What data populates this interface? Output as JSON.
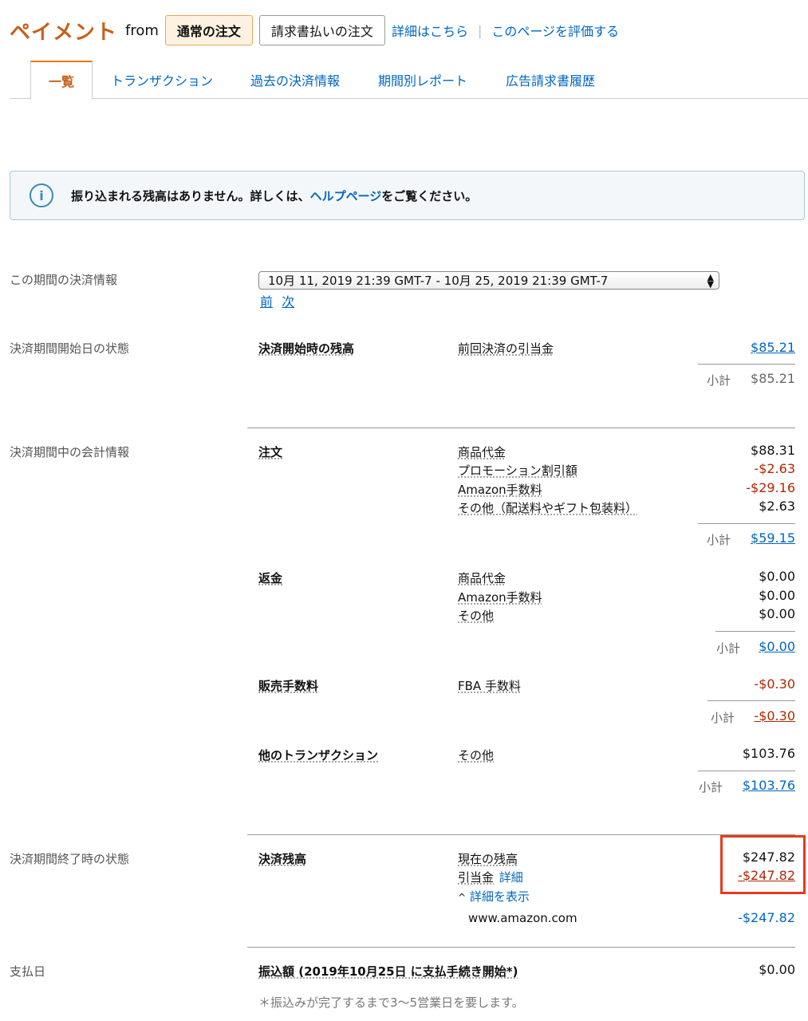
{
  "header": {
    "title": "ペイメント",
    "from": "from",
    "tab_regular": "通常の注文",
    "tab_invoice": "請求書払いの注文",
    "details_link": "詳細はこちら",
    "separator": "|",
    "rate_link": "このページを評価する"
  },
  "tabs": [
    "一覧",
    "トランザクション",
    "過去の決済情報",
    "期間別レポート",
    "広告請求書履歴"
  ],
  "info": {
    "icon": "info-icon",
    "icon_glyph": "i",
    "text_before": "振り込まれる残高はありません。詳しくは、",
    "link": "ヘルプページ",
    "text_after": "をご覧ください。"
  },
  "period": {
    "label": "この期間の決済情報",
    "selected": "10月 11, 2019 21:39 GMT-7 - 10月 25, 2019 21:39 GMT-7",
    "prev": "前",
    "next": "次"
  },
  "start": {
    "section": "決済期間開始日の状態",
    "group": "決済開始時の残高",
    "item": "前回決済の引当金",
    "amount": "$85.21",
    "subtotal_label": "小計",
    "subtotal": "$85.21"
  },
  "during": {
    "section": "決済期間中の会計情報",
    "orders": {
      "group": "注文",
      "items": [
        {
          "label": "商品代金",
          "amount": "$88.31"
        },
        {
          "label": "プロモーション割引額",
          "amount": "-$2.63"
        },
        {
          "label": "Amazon手数料",
          "amount": "-$29.16"
        },
        {
          "label": "その他（配送料やギフト包装料）",
          "amount": "$2.63"
        }
      ],
      "subtotal_label": "小計",
      "subtotal": "$59.15"
    },
    "refunds": {
      "group": "返金",
      "items": [
        {
          "label": "商品代金",
          "amount": "$0.00"
        },
        {
          "label": "Amazon手数料",
          "amount": "$0.00"
        },
        {
          "label": "その他",
          "amount": "$0.00"
        }
      ],
      "subtotal_label": "小計",
      "subtotal": "$0.00"
    },
    "fees": {
      "group": "販売手数料",
      "item": "FBA 手数料",
      "amount": "-$0.30",
      "subtotal_label": "小計",
      "subtotal": "-$0.30"
    },
    "other": {
      "group": "他のトランザクション",
      "item": "その他",
      "amount": "$103.76",
      "subtotal_label": "小計",
      "subtotal": "$103.76"
    }
  },
  "end": {
    "section": "決済期間終了時の状態",
    "group": "決済残高",
    "current_label": "現在の残高",
    "current_amount": "$247.82",
    "reserve_label": "引当金",
    "reserve_detail_link": "詳細",
    "reserve_amount": "-$247.82",
    "toggle_caret": "^",
    "toggle_label": "詳細を表示",
    "site": "www.amazon.com",
    "site_amount": "-$247.82"
  },
  "payment": {
    "section": "支払日",
    "label": "振込額 (2019年10月25日 に支払手続き開始*)",
    "amount": "$0.00",
    "note": "＊振込みが完了するまで3〜5営業日を要します。"
  },
  "colors": {
    "brand_orange": "#c7601b",
    "link_blue": "#0066c0",
    "negative_red": "#b12704",
    "highlight_red": "#e53b1f"
  }
}
